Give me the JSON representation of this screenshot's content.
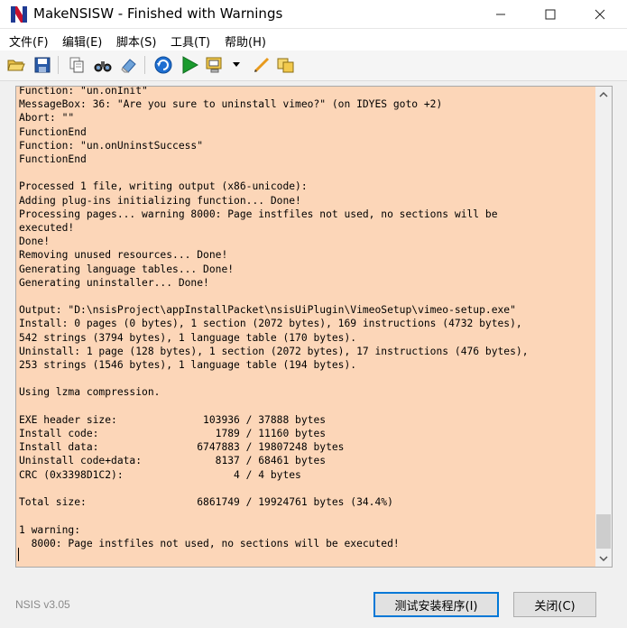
{
  "window": {
    "title": "MakeNSISW - Finished with Warnings",
    "minimize_icon": "minimize-icon",
    "maximize_icon": "maximize-icon",
    "close_icon": "close-icon"
  },
  "menu": {
    "items": [
      {
        "label": "文件(F)"
      },
      {
        "label": "编辑(E)"
      },
      {
        "label": "脚本(S)"
      },
      {
        "label": "工具(T)"
      },
      {
        "label": "帮助(H)"
      }
    ]
  },
  "toolbar": {
    "icons": [
      "open-folder-icon",
      "save-icon",
      "copy-icon",
      "find-icon",
      "clear-icon",
      "recompile-icon",
      "test-run-icon",
      "settings-dropdown-icon",
      "edit-script-icon",
      "browse-script-icon"
    ]
  },
  "log": {
    "background": "#fcd6b8",
    "lines": [
      "Function: \"un.onInit\"",
      "MessageBox: 36: \"Are you sure to uninstall vimeo?\" (on IDYES goto +2)",
      "Abort: \"\"",
      "FunctionEnd",
      "Function: \"un.onUninstSuccess\"",
      "FunctionEnd",
      "",
      "Processed 1 file, writing output (x86-unicode):",
      "Adding plug-ins initializing function... Done!",
      "Processing pages... warning 8000: Page instfiles not used, no sections will be",
      "executed!",
      "Done!",
      "Removing unused resources... Done!",
      "Generating language tables... Done!",
      "Generating uninstaller... Done!",
      "",
      "Output: \"D:\\nsisProject\\appInstallPacket\\nsisUiPlugin\\VimeoSetup\\vimeo-setup.exe\"",
      "Install: 0 pages (0 bytes), 1 section (2072 bytes), 169 instructions (4732 bytes),",
      "542 strings (3794 bytes), 1 language table (170 bytes).",
      "Uninstall: 1 page (128 bytes), 1 section (2072 bytes), 17 instructions (476 bytes),",
      "253 strings (1546 bytes), 1 language table (194 bytes).",
      "",
      "Using lzma compression.",
      "",
      "EXE header size:              103936 / 37888 bytes",
      "Install code:                   1789 / 11160 bytes",
      "Install data:                6747883 / 19807248 bytes",
      "Uninstall code+data:            8137 / 68461 bytes",
      "CRC (0x3398D1C2):                  4 / 4 bytes",
      "",
      "Total size:                  6861749 / 19924761 bytes (34.4%)",
      "",
      "1 warning:",
      "  8000: Page instfiles not used, no sections will be executed!"
    ]
  },
  "status": {
    "version": "NSIS v3.05"
  },
  "buttons": {
    "test_installer": "测试安装程序(I)",
    "close": "关闭(C)"
  }
}
